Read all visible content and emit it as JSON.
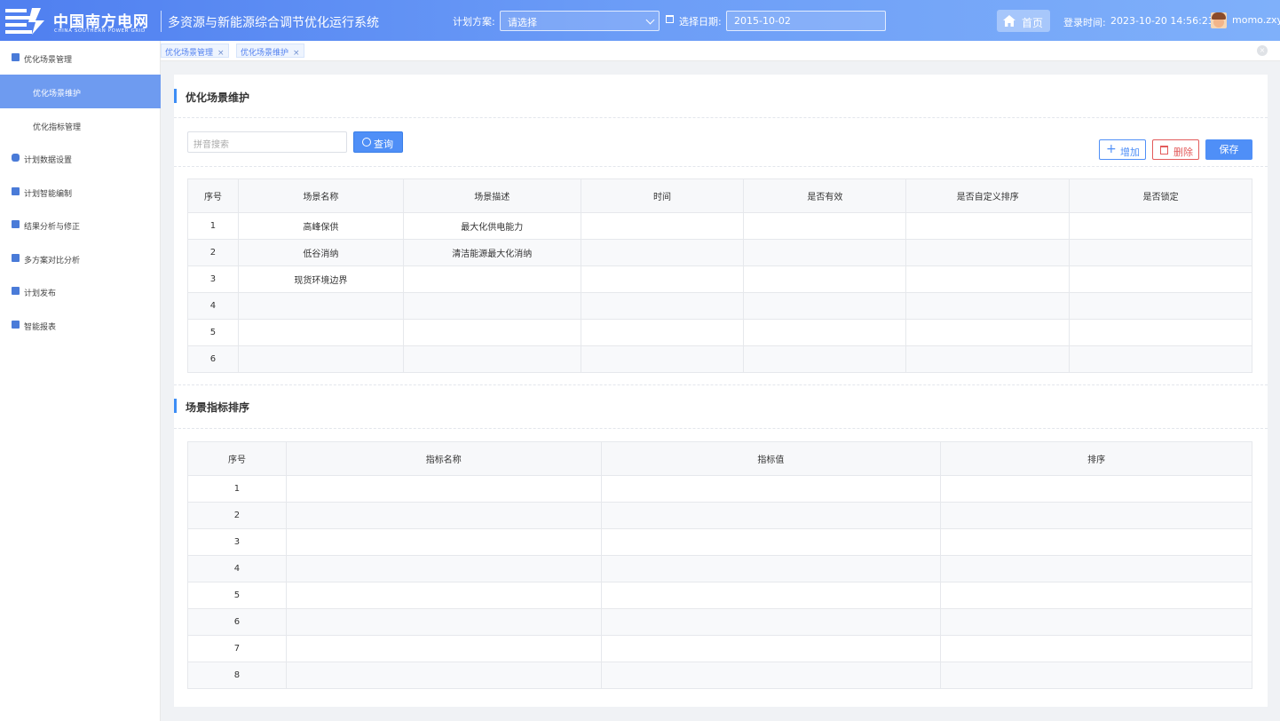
{
  "header": {
    "brand_cn": "中国南方电网",
    "brand_en": "CHINA SOUTHERN POWER GRID",
    "system_title": "多资源与新能源综合调节优化运行系统",
    "plan_label": "计划方案:",
    "plan_value": "请选择",
    "date_label": "选择日期:",
    "date_value": "2015-10-02",
    "home_label": "首页",
    "login_label": "登录时间:",
    "login_time": "2023-10-20 14:56:23",
    "username": "momo.zxy"
  },
  "sidebar": {
    "items": [
      {
        "label": "优化场景管理",
        "icon": "table-icon"
      },
      {
        "label": "优化场景维护",
        "icon": "",
        "sub": true,
        "active": true
      },
      {
        "label": "优化指标管理",
        "icon": "",
        "sub": true
      },
      {
        "label": "计划数据设置",
        "icon": "database-icon"
      },
      {
        "label": "计划智能编制",
        "icon": "document-icon"
      },
      {
        "label": "结果分析与修正",
        "icon": "chart-icon"
      },
      {
        "label": "多方案对比分析",
        "icon": "compare-icon"
      },
      {
        "label": "计划发布",
        "icon": "publish-icon"
      },
      {
        "label": "智能报表",
        "icon": "report-icon"
      }
    ]
  },
  "tabs": [
    {
      "label": "优化场景管理",
      "close": "×"
    },
    {
      "label": "优化场景维护",
      "close": "×"
    }
  ],
  "scene": {
    "title": "优化场景维护",
    "search_placeholder": "拼音搜索",
    "query_label": "查询",
    "add_label": "增加",
    "delete_label": "删除",
    "save_label": "保存",
    "columns": [
      "序号",
      "场景名称",
      "场景描述",
      "时间",
      "是否有效",
      "是否自定义排序",
      "是否锁定"
    ],
    "rows": [
      [
        "1",
        "高峰保供",
        "最大化供电能力",
        "",
        "",
        "",
        ""
      ],
      [
        "2",
        "低谷消纳",
        "清洁能源最大化消纳",
        "",
        "",
        "",
        ""
      ],
      [
        "3",
        "现货环境边界",
        "",
        "",
        "",
        "",
        ""
      ],
      [
        "4",
        "",
        "",
        "",
        "",
        "",
        ""
      ],
      [
        "5",
        "",
        "",
        "",
        "",
        "",
        ""
      ],
      [
        "6",
        "",
        "",
        "",
        "",
        "",
        ""
      ]
    ]
  },
  "indicator": {
    "title": "场景指标排序",
    "columns": [
      "序号",
      "指标名称",
      "指标值",
      "排序"
    ],
    "rows": [
      [
        "1",
        "",
        "",
        ""
      ],
      [
        "2",
        "",
        "",
        ""
      ],
      [
        "3",
        "",
        "",
        ""
      ],
      [
        "4",
        "",
        "",
        ""
      ],
      [
        "5",
        "",
        "",
        ""
      ],
      [
        "6",
        "",
        "",
        ""
      ],
      [
        "7",
        "",
        "",
        ""
      ],
      [
        "8",
        "",
        "",
        ""
      ]
    ]
  },
  "colors": {
    "header_start": "#4f7ff0",
    "accent": "#4f8ff7",
    "danger": "#e35b5b",
    "active_nav": "#6e9bf0"
  }
}
